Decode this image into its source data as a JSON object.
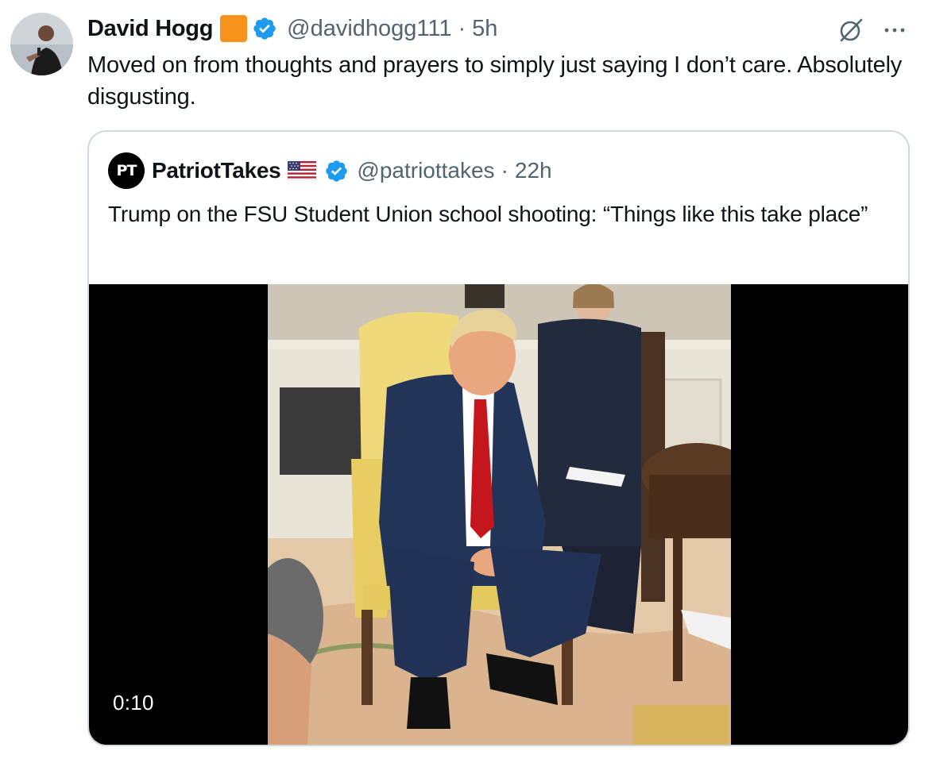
{
  "tweet": {
    "author": {
      "display_name": "David Hogg",
      "handle": "@davidhogg111",
      "avatar_icon": "profile-photo",
      "org_badge_color": "#f7931a",
      "verified_icon": "verified-badge-icon"
    },
    "separator": "·",
    "timestamp": "5h",
    "text": "Moved on from thoughts and prayers to simply just saying I don’t care. Absolutely disgusting.",
    "actions": {
      "grok_icon": "grok-icon",
      "more_icon": "more-options-icon"
    }
  },
  "quoted_tweet": {
    "author": {
      "display_name": "PatriotTakes",
      "avatar_text": "PT",
      "handle": "@patriottakes",
      "flag_icon": "us-flag-icon",
      "verified_icon": "verified-badge-icon"
    },
    "separator": "·",
    "timestamp": "22h",
    "text": "Trump on the FSU Student Union school shooting: “Things like this take place”",
    "media": {
      "type": "video",
      "duration": "0:10"
    }
  },
  "colors": {
    "text_primary": "#0f1419",
    "text_secondary": "#536471",
    "verified_blue": "#1d9bf0",
    "border": "#cfd9de"
  }
}
